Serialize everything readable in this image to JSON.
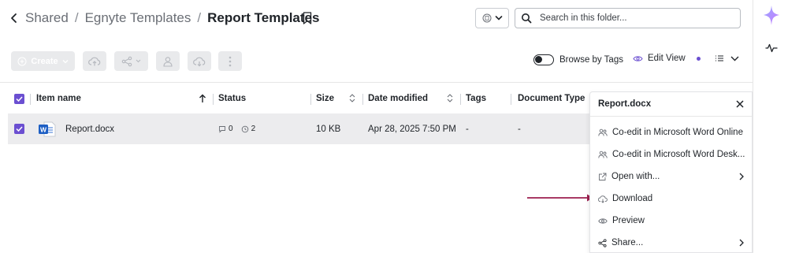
{
  "breadcrumb": {
    "items": [
      "Shared",
      "Egnyte Templates"
    ],
    "current": "Report Templates",
    "separator": "/"
  },
  "search": {
    "placeholder": "Search in this folder..."
  },
  "toolbar": {
    "create_label": "Create",
    "browse_by_tags_label": "Browse by Tags",
    "edit_view_label": "Edit View",
    "accent": "#6b4fd1"
  },
  "table": {
    "columns": {
      "item_name": "Item name",
      "status": "Status",
      "size": "Size",
      "date_modified": "Date modified",
      "tags": "Tags",
      "document_type": "Document Type"
    },
    "rows": [
      {
        "name": "Report.docx",
        "comments": "0",
        "versions": "2",
        "size": "10 KB",
        "date": "Apr 28, 2025 7:50 PM",
        "tags": "-",
        "doc_type": "-"
      }
    ]
  },
  "context_menu": {
    "title": "Report.docx",
    "items": [
      {
        "label": "Co-edit in Microsoft Word Online",
        "icon": "co-edit-icon"
      },
      {
        "label": "Co-edit in Microsoft Word Desk...",
        "icon": "co-edit-icon"
      },
      {
        "label": "Open with...",
        "icon": "external-link-icon"
      },
      {
        "label": "Download",
        "icon": "cloud-download-icon"
      },
      {
        "label": "Preview",
        "icon": "eye-icon"
      },
      {
        "label": "Share...",
        "icon": "share-icon"
      }
    ]
  },
  "annotation": {
    "arrow_color": "#9b1f4f"
  }
}
